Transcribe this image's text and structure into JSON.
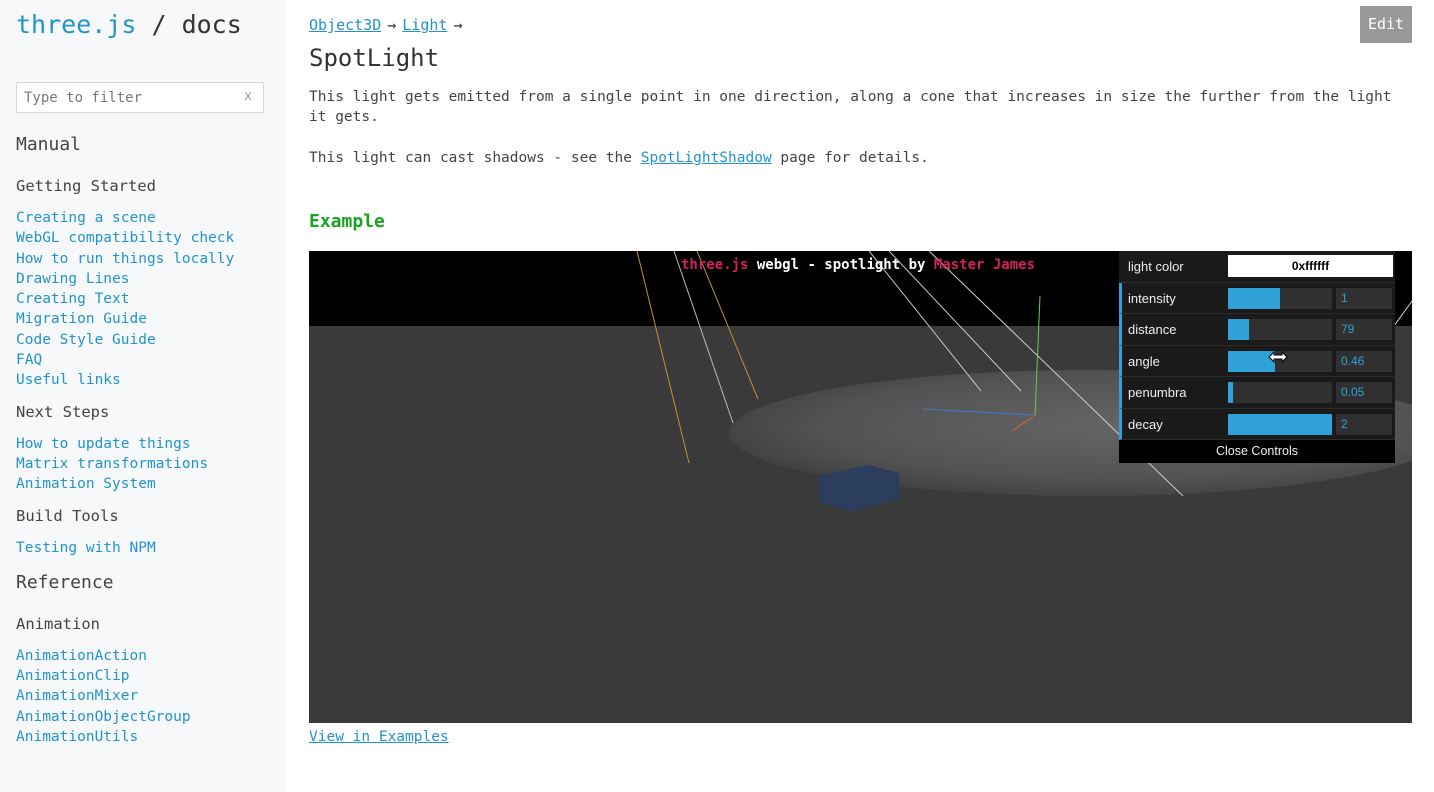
{
  "sidebar": {
    "brand": {
      "lib": "three.js",
      "sep": " / ",
      "docs": "docs"
    },
    "filter": {
      "placeholder": "Type to filter",
      "value": "",
      "clear": "x"
    },
    "sections": [
      {
        "title": "Manual",
        "groups": [
          {
            "title": "Getting Started",
            "items": [
              "Creating a scene",
              "WebGL compatibility check",
              "How to run things locally",
              "Drawing Lines",
              "Creating Text",
              "Migration Guide",
              "Code Style Guide",
              "FAQ",
              "Useful links"
            ]
          },
          {
            "title": "Next Steps",
            "items": [
              "How to update things",
              "Matrix transformations",
              "Animation System"
            ]
          },
          {
            "title": "Build Tools",
            "items": [
              "Testing with NPM"
            ]
          }
        ]
      },
      {
        "title": "Reference",
        "groups": [
          {
            "title": "Animation",
            "items": [
              "AnimationAction",
              "AnimationClip",
              "AnimationMixer",
              "AnimationObjectGroup",
              "AnimationUtils"
            ]
          }
        ]
      }
    ]
  },
  "header": {
    "edit_label": "Edit"
  },
  "breadcrumb": {
    "items": [
      "Object3D",
      "Light"
    ],
    "arrow": "→"
  },
  "page": {
    "title": "SpotLight",
    "desc1": "This light gets emitted from a single point in one direction, along a cone that increases in size the further from the light it gets.",
    "desc2_before": "This light can cast shadows - see the ",
    "desc2_link": "SpotLightShadow",
    "desc2_after": " page for details.",
    "example_heading": "Example",
    "view_examples": "View in Examples"
  },
  "demo": {
    "title_lib": "three.js",
    "title_mid": " webgl - spotlight by ",
    "title_author": "Master James"
  },
  "gui": {
    "color": {
      "label": "light color",
      "value": "0xffffff"
    },
    "params": [
      {
        "key": "intensity",
        "label": "intensity",
        "value": "1",
        "fill": 0.5
      },
      {
        "key": "distance",
        "label": "distance",
        "value": "79",
        "fill": 0.2
      },
      {
        "key": "angle",
        "label": "angle",
        "value": "0.46",
        "fill": 0.45
      },
      {
        "key": "penumbra",
        "label": "penumbra",
        "value": "0.05",
        "fill": 0.05
      },
      {
        "key": "decay",
        "label": "decay",
        "value": "2",
        "fill": 1.0
      }
    ],
    "close_label": "Close Controls"
  },
  "colors": {
    "link": "#2194ce",
    "example": "#17a31d",
    "gui_accent": "#2fa1d6",
    "demo_accent": "#d0205e"
  }
}
